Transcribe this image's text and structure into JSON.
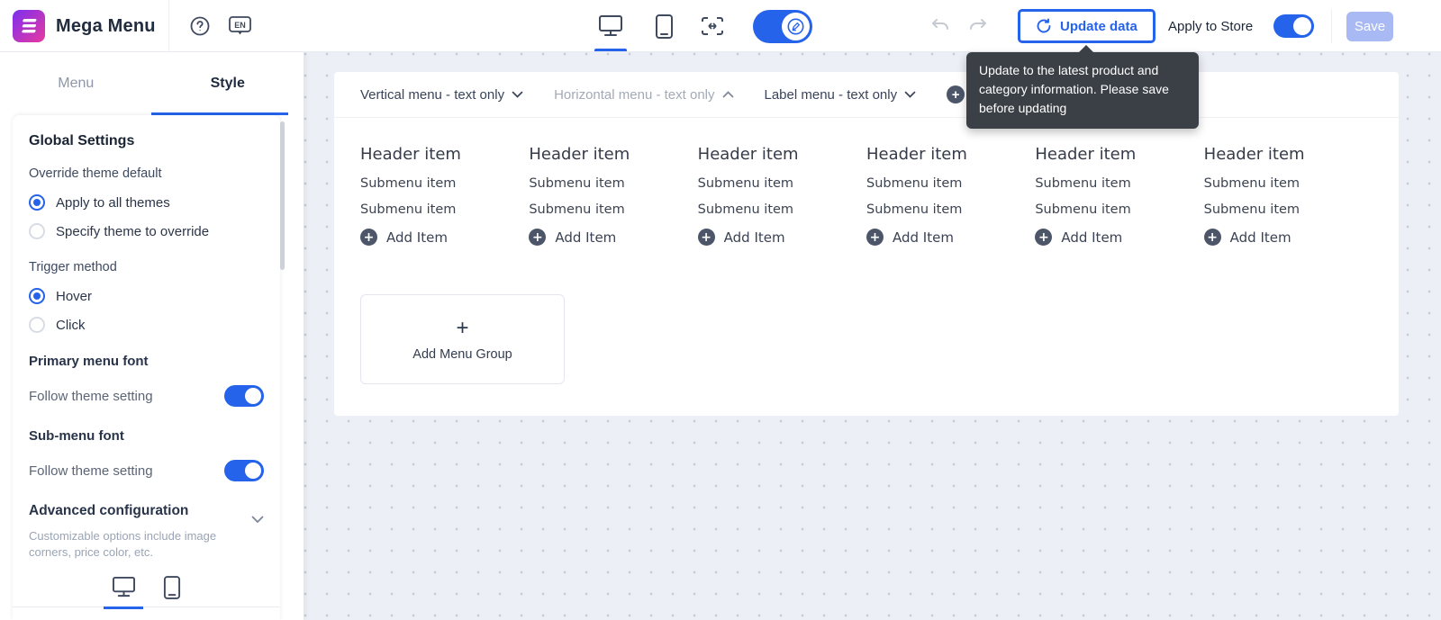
{
  "glyphs": {
    "plus": "+",
    "help": "?"
  },
  "topbar": {
    "app_title": "Mega Menu",
    "language_label": "EN",
    "icons": [
      "app-logo-icon",
      "help-icon",
      "language-en-icon",
      "desktop-preview-icon",
      "mobile-preview-icon",
      "full-width-preview-icon",
      "edit-mode-pencil-icon",
      "undo-icon",
      "redo-icon",
      "refresh-icon"
    ],
    "update_button_label": "Update data",
    "apply_to_store_label": "Apply to Store",
    "save_label": "Save"
  },
  "tooltip": {
    "text": "Update to the latest product and category information. Please save before updating"
  },
  "sidebar": {
    "tabs": {
      "menu": "Menu",
      "style": "Style"
    },
    "global_settings": {
      "title": "Global Settings",
      "override_label": "Override theme default",
      "override_options": [
        "Apply to all themes",
        "Specify theme to override"
      ],
      "trigger_label": "Trigger method",
      "trigger_options": [
        "Hover",
        "Click"
      ],
      "primary_font_label": "Primary menu font",
      "primary_font_toggle_label": "Follow theme setting",
      "submenu_font_label": "Sub-menu font",
      "submenu_font_toggle_label": "Follow theme setting",
      "advanced_label": "Advanced configuration",
      "advanced_desc": "Customizable options include image corners, price color, etc."
    }
  },
  "preview": {
    "menu_tabs": [
      {
        "label": "Vertical menu - text only",
        "chevron": "down"
      },
      {
        "label": "Horizontal menu - text only",
        "chevron": "up"
      },
      {
        "label": "Label menu - text only",
        "chevron": "down"
      }
    ],
    "columns": [
      {
        "header": "Header item",
        "item1": "Submenu item",
        "item2": "Submenu item",
        "add": "Add Item"
      },
      {
        "header": "Header item",
        "item1": "Submenu item",
        "item2": "Submenu item",
        "add": "Add Item"
      },
      {
        "header": "Header item",
        "item1": "Submenu item",
        "item2": "Submenu item",
        "add": "Add Item"
      },
      {
        "header": "Header item",
        "item1": "Submenu item",
        "item2": "Submenu item",
        "add": "Add Item"
      },
      {
        "header": "Header item",
        "item1": "Submenu item",
        "item2": "Submenu item",
        "add": "Add Item"
      },
      {
        "header": "Header item",
        "item1": "Submenu item",
        "item2": "Submenu item",
        "add": "Add Item"
      }
    ],
    "add_menu_group_label": "Add Menu Group"
  },
  "colors": {
    "accent": "#2563eb",
    "save_disabled_bg": "#a8b9f4",
    "tooltip_bg": "#3b4046",
    "canvas_bg": "#edeff6",
    "dot_color": "#c7cbd7",
    "dark_text": "#222c3f"
  }
}
